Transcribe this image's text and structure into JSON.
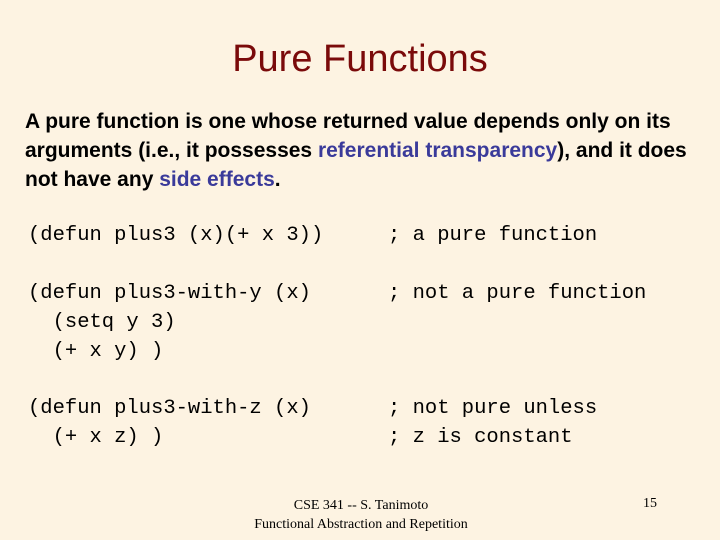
{
  "slide": {
    "title": "Pure Functions",
    "intro": {
      "part1": "A pure function is one whose returned value depends only on its arguments (i.e., it possesses ",
      "term1": "referential transparency",
      "part2": "), and it does not have any ",
      "term2": "side effects",
      "part3": "."
    },
    "code_blocks": [
      {
        "lines": [
          "(defun plus3 (x)(+ x 3))"
        ],
        "comments": [
          "; a pure function"
        ]
      },
      {
        "lines": [
          "(defun plus3-with-y (x)",
          "  (setq y 3)",
          "  (+ x y) )"
        ],
        "comments": [
          "; not a pure function"
        ]
      },
      {
        "lines": [
          "(defun plus3-with-z (x)",
          "  (+ x z) )"
        ],
        "comments": [
          "; not pure unless",
          "; z is constant"
        ]
      }
    ],
    "footer": {
      "line1": "CSE 341 -- S. Tanimoto",
      "line2": "Functional Abstraction and Repetition",
      "page_number": "15"
    },
    "colors": {
      "background": "#fdf3e2",
      "title": "#7a0a0a",
      "highlight": "#3a3a9a"
    }
  }
}
